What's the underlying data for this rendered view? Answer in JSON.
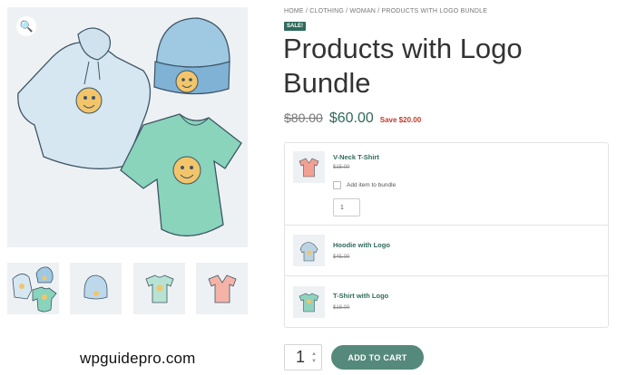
{
  "breadcrumb": "HOME / CLOTHING / WOMAN / PRODUCTS WITH LOGO BUNDLE",
  "sale_badge": "SALE!",
  "title": "Products with Logo Bundle",
  "price": {
    "old": "$80.00",
    "new": "$60.00",
    "save": "Save $20.00"
  },
  "gallery": {
    "zoom_icon": "magnifier-icon",
    "thumbs": [
      "bundle-all",
      "beanie",
      "t-shirt",
      "v-neck-t-shirt"
    ]
  },
  "bundle": {
    "items": [
      {
        "name": "V-Neck T-Shirt",
        "price": "$15.00",
        "checkbox_label": "Add item to bundle",
        "qty": "1",
        "color": "#f2a091"
      },
      {
        "name": "Hoodie with Logo",
        "price": "$45.00",
        "color": "#bcd4e2"
      },
      {
        "name": "T-Shirt with Logo",
        "price": "$18.00",
        "color": "#8fd3bd"
      }
    ]
  },
  "cart": {
    "qty": "1",
    "add_label": "ADD TO CART"
  },
  "site_mark": "wpguidepro.com",
  "colors": {
    "accent": "#2f6a5c",
    "button": "#55897b",
    "save": "#c0392b"
  }
}
